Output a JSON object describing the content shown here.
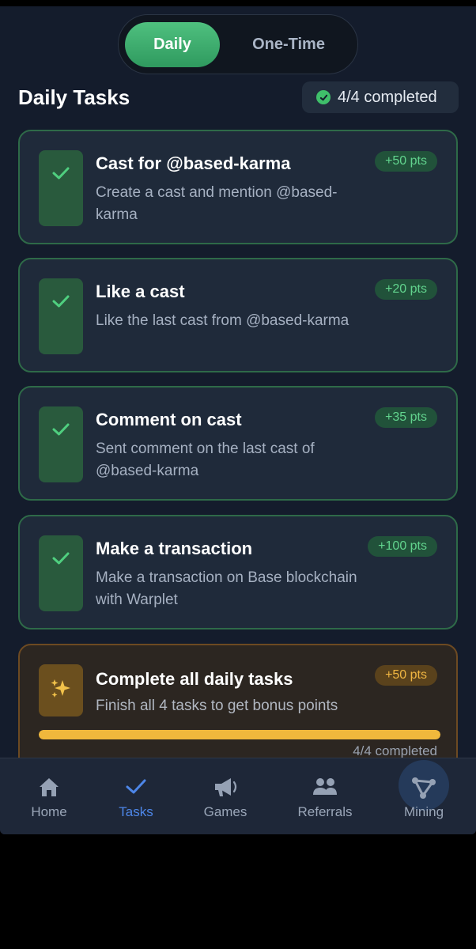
{
  "toggle": {
    "daily": "Daily",
    "one_time": "One-Time"
  },
  "header": {
    "title": "Daily Tasks",
    "summary": "4/4 completed"
  },
  "tasks": [
    {
      "title": "Cast for @based-karma",
      "description": "Create a cast and mention @based-karma",
      "points": "+50 pts",
      "completed": true,
      "icon": "check-icon"
    },
    {
      "title": "Like a cast",
      "description": "Like the last cast from @based-karma",
      "points": "+20 pts",
      "completed": true,
      "icon": "check-icon"
    },
    {
      "title": "Comment on cast",
      "description": "Sent comment on the last cast of @based-karma",
      "points": "+35 pts",
      "completed": true,
      "icon": "check-icon"
    },
    {
      "title": "Make a transaction",
      "description": "Make a transaction on Base blockchain with Warplet",
      "points": "+100 pts",
      "completed": true,
      "icon": "check-icon"
    }
  ],
  "bonus": {
    "title": "Complete all daily tasks",
    "description": "Finish all 4 tasks to get bonus points",
    "points": "+50 pts",
    "progress_label": "4/4 completed",
    "progress": 1.0,
    "icon": "sparkles-icon"
  },
  "nav": [
    {
      "label": "Home",
      "icon": "home-icon"
    },
    {
      "label": "Tasks",
      "icon": "check-icon",
      "active": true
    },
    {
      "label": "Games",
      "icon": "megaphone-icon"
    },
    {
      "label": "Referrals",
      "icon": "users-icon"
    },
    {
      "label": "Mining",
      "icon": "network-icon"
    }
  ],
  "colors": {
    "accent_green": "#3fbf6a",
    "accent_blue": "#4d86e8",
    "bonus_gold": "#f0b83c",
    "background": "#141c2c"
  }
}
